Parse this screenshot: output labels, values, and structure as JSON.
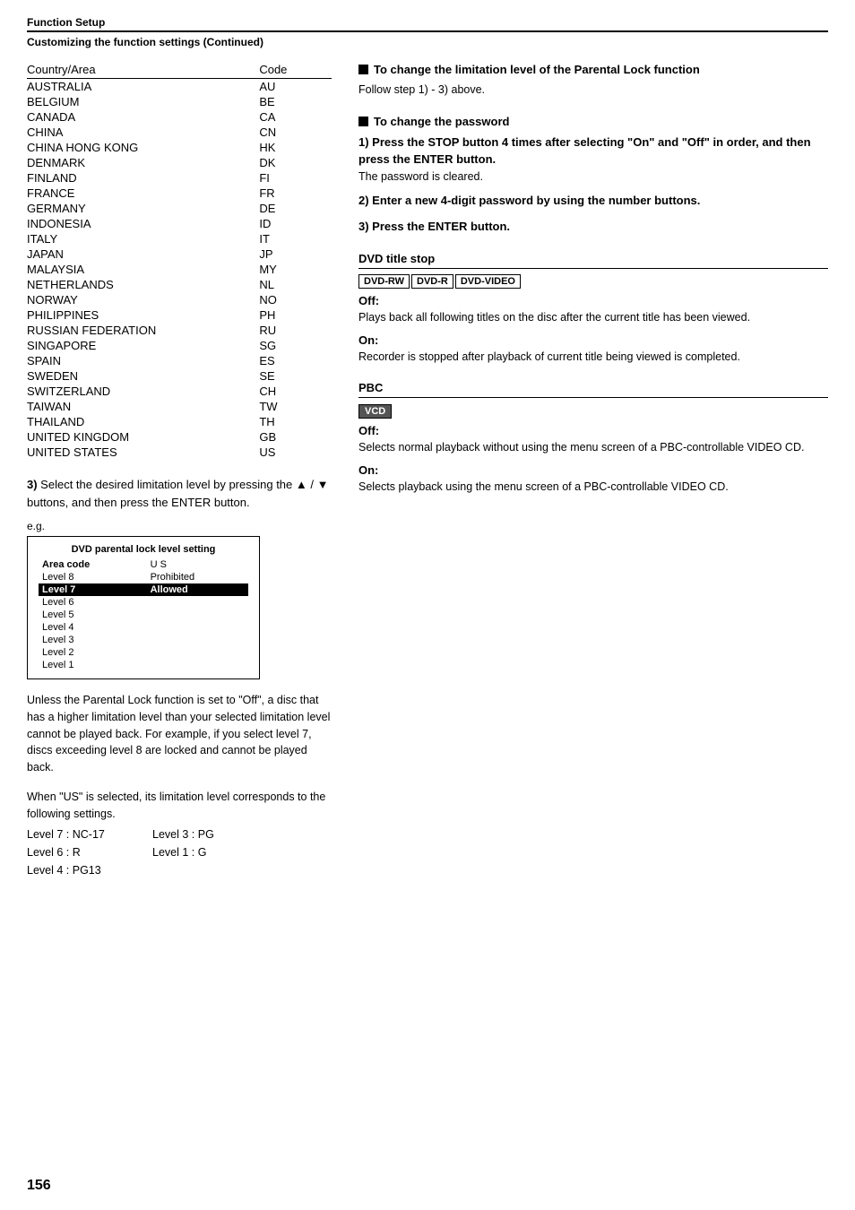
{
  "header": {
    "title": "Function Setup",
    "subheader": "Customizing the function settings (Continued)"
  },
  "left": {
    "country_table": {
      "col1_header": "Country/Area",
      "col2_header": "Code",
      "rows": [
        [
          "AUSTRALIA",
          "AU"
        ],
        [
          "BELGIUM",
          "BE"
        ],
        [
          "CANADA",
          "CA"
        ],
        [
          "CHINA",
          "CN"
        ],
        [
          "CHINA HONG KONG",
          "HK"
        ],
        [
          "DENMARK",
          "DK"
        ],
        [
          "FINLAND",
          "FI"
        ],
        [
          "FRANCE",
          "FR"
        ],
        [
          "GERMANY",
          "DE"
        ],
        [
          "INDONESIA",
          "ID"
        ],
        [
          "ITALY",
          "IT"
        ],
        [
          "JAPAN",
          "JP"
        ],
        [
          "MALAYSIA",
          "MY"
        ],
        [
          "NETHERLANDS",
          "NL"
        ],
        [
          "NORWAY",
          "NO"
        ],
        [
          "PHILIPPINES",
          "PH"
        ],
        [
          "RUSSIAN FEDERATION",
          "RU"
        ],
        [
          "SINGAPORE",
          "SG"
        ],
        [
          "SPAIN",
          "ES"
        ],
        [
          "SWEDEN",
          "SE"
        ],
        [
          "SWITZERLAND",
          "CH"
        ],
        [
          "TAIWAN",
          "TW"
        ],
        [
          "THAILAND",
          "TH"
        ],
        [
          "UNITED KINGDOM",
          "GB"
        ],
        [
          "UNITED STATES",
          "US"
        ]
      ]
    },
    "step3": {
      "number": "3)",
      "text": "Select the desired limitation level by pressing the ▲ / ▼ buttons, and then press the ENTER button."
    },
    "eg": {
      "label": "e.g.",
      "box_title": "DVD parental lock level setting",
      "area_code_label": "Area code",
      "area_code_value": "U S",
      "rows": [
        {
          "label": "Level 8",
          "value": "Prohibited",
          "highlighted": false
        },
        {
          "label": "Level 7",
          "value": "Allowed",
          "highlighted": true
        },
        {
          "label": "Level 6",
          "value": "",
          "highlighted": false
        },
        {
          "label": "Level 5",
          "value": "",
          "highlighted": false
        },
        {
          "label": "Level 4",
          "value": "",
          "highlighted": false
        },
        {
          "label": "Level 3",
          "value": "",
          "highlighted": false
        },
        {
          "label": "Level 2",
          "value": "",
          "highlighted": false
        },
        {
          "label": "Level 1",
          "value": "",
          "highlighted": false
        }
      ]
    },
    "parental_note": "Unless the Parental Lock function is set to \"Off\", a disc that has a higher limitation level than your selected limitation level cannot be played back. For example, if you select level 7, discs exceeding  level 8 are locked and cannot be played back.",
    "us_note": "When \"US\" is selected, its limitation level corresponds to the following settings.",
    "levels": [
      {
        "left": "Level 7 : NC-17",
        "right": "Level 3 : PG"
      },
      {
        "left": "Level 6 : R",
        "right": "Level 1 : G"
      },
      {
        "left": "Level 4 : PG13",
        "right": ""
      }
    ]
  },
  "right": {
    "parental_lock_section": {
      "heading": "To change the limitation level of the Parental Lock function",
      "text": "Follow step 1) - 3) above."
    },
    "password_section": {
      "heading": "To change the password",
      "steps": [
        {
          "number": "1)",
          "bold_text": "Press the STOP button 4 times after selecting \"On\" and \"Off\" in order, and then press the ENTER button.",
          "sub_text": "The password is cleared."
        },
        {
          "number": "2)",
          "bold_text": "Enter a new 4-digit password by using the number buttons.",
          "sub_text": ""
        },
        {
          "number": "3)",
          "bold_text": "Press the ENTER button.",
          "sub_text": ""
        }
      ]
    },
    "dvd_title_stop": {
      "title": "DVD title stop",
      "badges": [
        "DVD-RW",
        "DVD-R",
        "DVD-VIDEO"
      ],
      "off_label": "Off:",
      "off_text": "Plays back all following titles on the disc after the current title has been viewed.",
      "on_label": "On:",
      "on_text": "Recorder is stopped after playback of current title being viewed is completed."
    },
    "pbc": {
      "title": "PBC",
      "badge": "VCD",
      "off_label": "Off:",
      "off_text": "Selects normal playback without using the menu screen of a PBC-controllable VIDEO CD.",
      "on_label": "On:",
      "on_text": "Selects playback using the menu screen of a PBC-controllable VIDEO CD."
    }
  },
  "page_number": "156"
}
